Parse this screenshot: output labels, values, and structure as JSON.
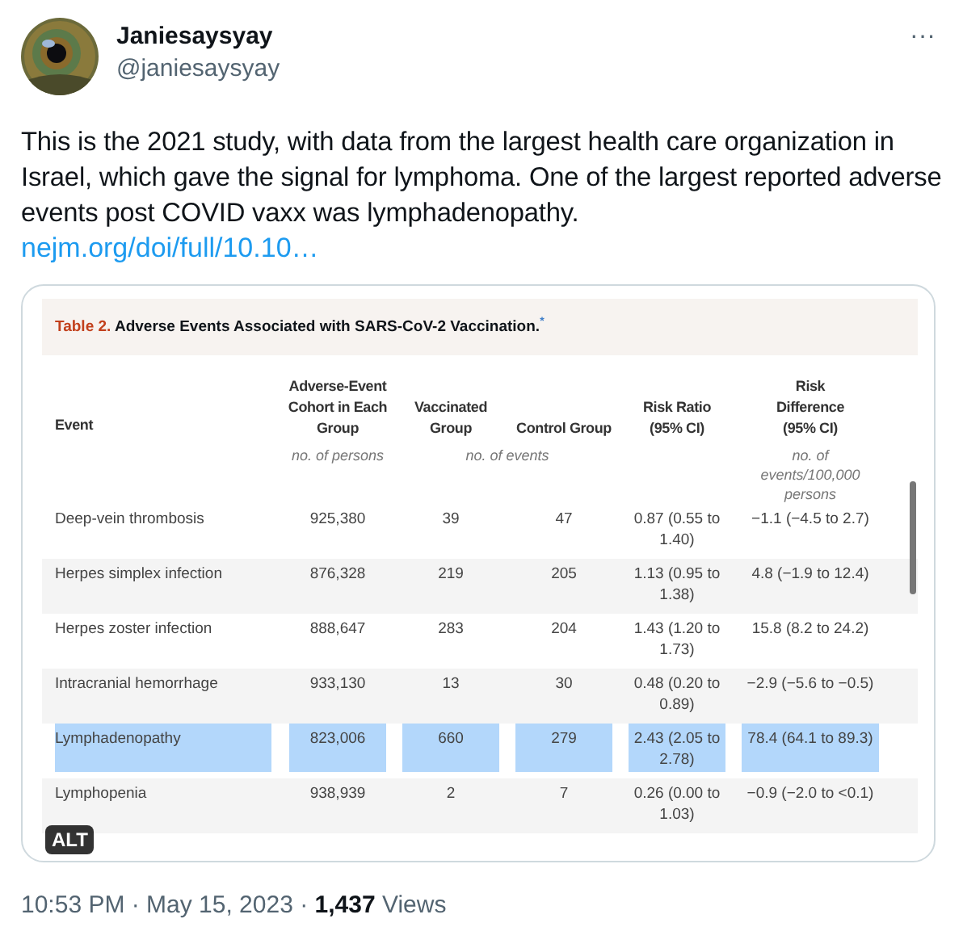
{
  "author": {
    "name": "Janiesaysyay",
    "handle": "@janiesaysyay"
  },
  "menu": "···",
  "text": "This is the 2021 study, with data from the largest health care organization in Israel, which gave the signal for lymphoma. One of the largest reported adverse events post COVID vaxx was lymphadenopathy.",
  "link": "nejm.org/doi/full/10.10…",
  "media": {
    "table_title_label": "Table 2.",
    "table_title": "Adverse Events Associated with SARS-CoV-2 Vaccination.",
    "title_mark": "*",
    "columns": [
      {
        "heading": "Event"
      },
      {
        "heading": "Adverse-Event Cohort in Each Group",
        "unit": "no. of persons"
      },
      {
        "heading": "Vaccinated Group"
      },
      {
        "heading": "Control Group"
      },
      {
        "heading": "Risk Ratio (95% CI)"
      },
      {
        "heading": "Risk Difference (95% CI)",
        "unit": "no. of events/100,000 persons"
      }
    ],
    "group_unit": "no. of events",
    "rows": [
      {
        "cells": [
          "Deep-vein thrombosis",
          "925,380",
          "39",
          "47",
          "0.87 (0.55 to 1.40)",
          "−1.1 (−4.5 to 2.7)"
        ],
        "highlighted": false
      },
      {
        "cells": [
          "Herpes simplex infection",
          "876,328",
          "219",
          "205",
          "1.13 (0.95 to 1.38)",
          "4.8 (−1.9 to 12.4)"
        ],
        "highlighted": false
      },
      {
        "cells": [
          "Herpes zoster infection",
          "888,647",
          "283",
          "204",
          "1.43 (1.20 to 1.73)",
          "15.8 (8.2 to 24.2)"
        ],
        "highlighted": false
      },
      {
        "cells": [
          "Intracranial hemorrhage",
          "933,130",
          "13",
          "30",
          "0.48 (0.20 to 0.89)",
          "−2.9 (−5.6 to −0.5)"
        ],
        "highlighted": false
      },
      {
        "cells": [
          "Lymphadenopathy",
          "823,006",
          "660",
          "279",
          "2.43 (2.05 to 2.78)",
          "78.4 (64.1 to 89.3)"
        ],
        "highlighted": true
      },
      {
        "cells": [
          "Lymphopenia",
          "938,939",
          "2",
          "7",
          "0.26 (0.00 to 1.03)",
          "−0.9 (−2.0 to <0.1)"
        ],
        "highlighted": false
      }
    ],
    "alt_badge": "ALT"
  },
  "footer": {
    "time": "10:53 PM · May 15, 2023 · ",
    "views_count": "1,437",
    "views_label": " Views"
  }
}
